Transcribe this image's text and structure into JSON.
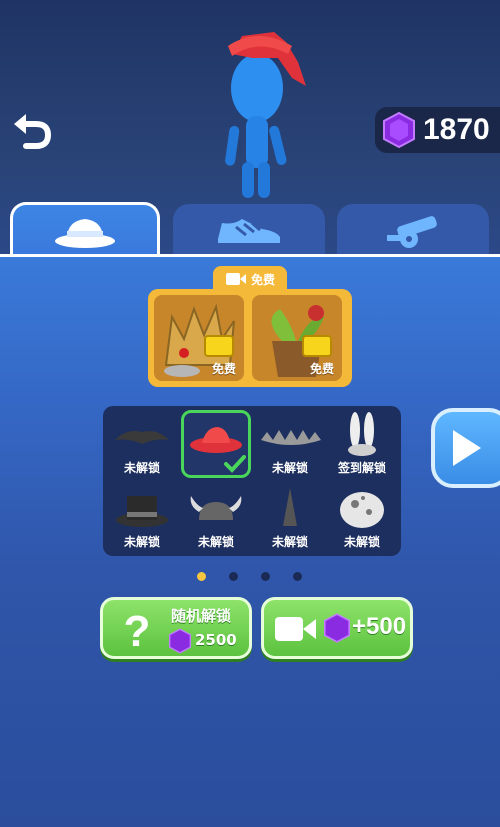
{
  "header": {
    "gem_count": "1870",
    "back_icon": "back-arrow-icon"
  },
  "tabs": [
    {
      "name": "hats",
      "icon": "hat-icon",
      "active": true
    },
    {
      "name": "shoes",
      "icon": "shoe-icon",
      "active": false
    },
    {
      "name": "weapons",
      "icon": "cannon-icon",
      "active": false
    }
  ],
  "free_offer": {
    "tag_label": "免费",
    "items": [
      {
        "icon": "crown-icon",
        "label": "免费"
      },
      {
        "icon": "plant-pot-icon",
        "label": "免费"
      }
    ]
  },
  "grid": {
    "items": [
      {
        "icon": "dark-hat-icon",
        "label": "未解锁"
      },
      {
        "icon": "red-hat-icon",
        "label": "",
        "selected": true
      },
      {
        "icon": "spiky-band-icon",
        "label": "未解锁"
      },
      {
        "icon": "bunny-ears-icon",
        "label": "签到解锁"
      },
      {
        "icon": "top-hat-icon",
        "label": "未解锁"
      },
      {
        "icon": "viking-helmet-icon",
        "label": "未解锁"
      },
      {
        "icon": "spike-cone-icon",
        "label": "未解锁"
      },
      {
        "icon": "egg-icon",
        "label": "未解锁"
      }
    ]
  },
  "pager": {
    "pages": 4,
    "current": 1
  },
  "buttons": {
    "random_unlock_label": "随机解锁",
    "random_unlock_price": "2500",
    "ad_reward_label": "+500"
  },
  "colors": {
    "accent_green": "#5cc23f",
    "gem_purple": "#8a2be2",
    "gold": "#f5b93a",
    "select_green": "#49d65a"
  }
}
